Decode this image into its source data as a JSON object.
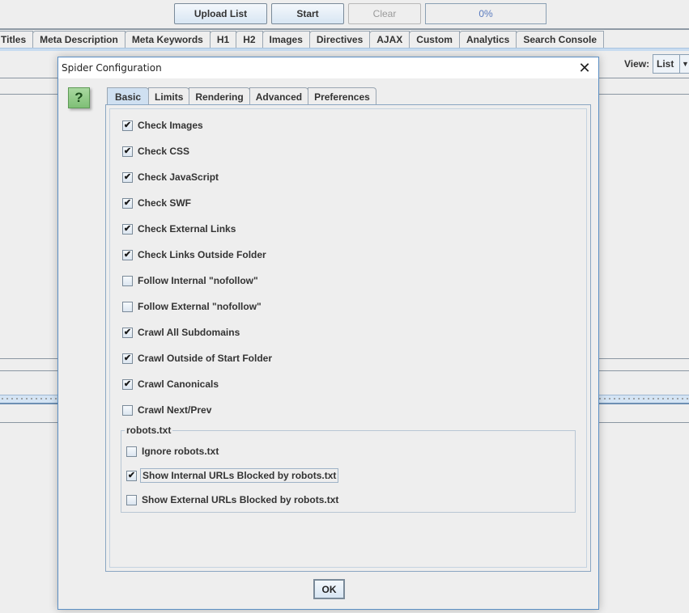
{
  "toolbar": {
    "upload_list": "Upload List",
    "start": "Start",
    "clear": "Clear",
    "progress": "0%"
  },
  "main_tabs": [
    "Titles",
    "Meta Description",
    "Meta Keywords",
    "H1",
    "H2",
    "Images",
    "Directives",
    "AJAX",
    "Custom",
    "Analytics",
    "Search Console"
  ],
  "view": {
    "label": "View:",
    "selected": "List"
  },
  "dialog": {
    "title": "Spider Configuration",
    "help_label": "?",
    "tabs": [
      {
        "label": "Basic",
        "active": true
      },
      {
        "label": "Limits",
        "active": false
      },
      {
        "label": "Rendering",
        "active": false
      },
      {
        "label": "Advanced",
        "active": false
      },
      {
        "label": "Preferences",
        "active": false
      }
    ],
    "options": [
      {
        "label": "Check Images",
        "checked": true
      },
      {
        "label": "Check CSS",
        "checked": true
      },
      {
        "label": "Check JavaScript",
        "checked": true
      },
      {
        "label": "Check SWF",
        "checked": true
      },
      {
        "label": "Check External Links",
        "checked": true
      },
      {
        "label": "Check Links Outside Folder",
        "checked": true
      },
      {
        "label": "Follow Internal \"nofollow\"",
        "checked": false
      },
      {
        "label": "Follow External \"nofollow\"",
        "checked": false
      },
      {
        "label": "Crawl All Subdomains",
        "checked": true
      },
      {
        "label": "Crawl Outside of Start Folder",
        "checked": true
      },
      {
        "label": "Crawl Canonicals",
        "checked": true
      },
      {
        "label": "Crawl Next/Prev",
        "checked": false
      }
    ],
    "robots": {
      "legend": "robots.txt",
      "options": [
        {
          "label": "Ignore robots.txt",
          "checked": false
        },
        {
          "label": "Show Internal URLs Blocked by robots.txt",
          "checked": true
        },
        {
          "label": "Show External URLs Blocked by robots.txt",
          "checked": false
        }
      ]
    },
    "ok_label": "OK",
    "check_glyph": "✔"
  }
}
